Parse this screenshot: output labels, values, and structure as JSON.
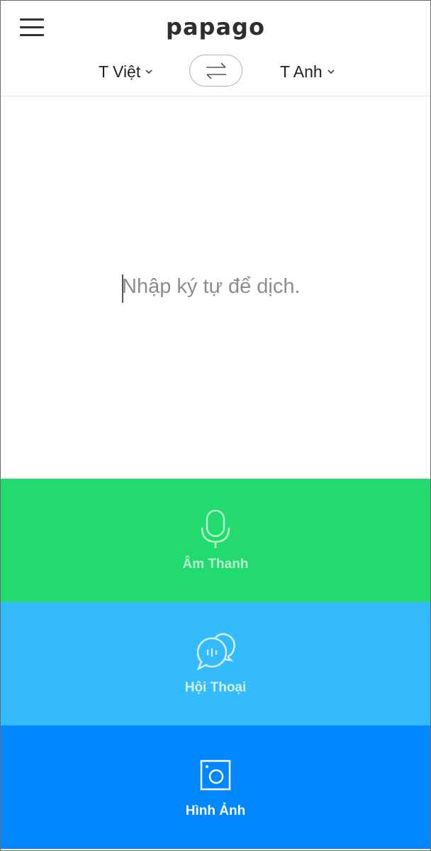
{
  "header": {
    "logo": "papago",
    "source_lang": "T Việt",
    "target_lang": "T Anh"
  },
  "input": {
    "placeholder": "Nhập ký tự để dịch."
  },
  "actions": [
    {
      "label": "Âm Thanh",
      "icon": "microphone-icon",
      "color": "#22da6e"
    },
    {
      "label": "Hội Thoại",
      "icon": "chat-bubbles-icon",
      "color": "#33bbfe"
    },
    {
      "label": "Hình Ảnh",
      "icon": "camera-icon",
      "color": "#0187fd"
    }
  ]
}
